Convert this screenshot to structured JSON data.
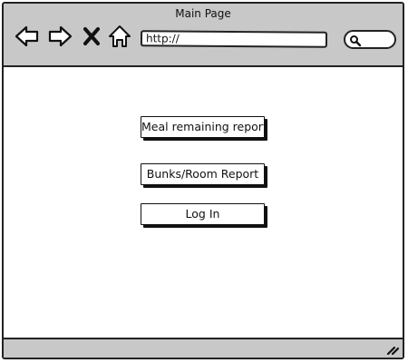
{
  "window": {
    "title": "Main Page"
  },
  "toolbar": {
    "icons": {
      "back": "arrow-left-icon",
      "forward": "arrow-right-icon",
      "stop": "close-icon",
      "home": "home-icon",
      "search": "search-icon",
      "resize": "resize-grip-icon"
    },
    "address": "http://"
  },
  "main": {
    "buttons": [
      {
        "label": "Meal remaining report"
      },
      {
        "label": "Bunks/Room Report"
      },
      {
        "label": "Log In"
      }
    ]
  }
}
